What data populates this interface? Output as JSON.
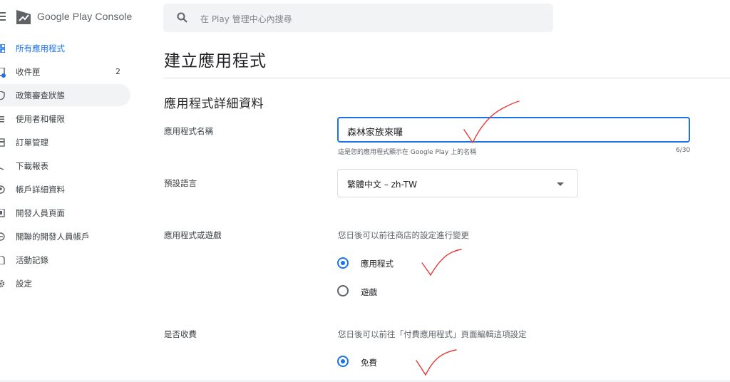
{
  "app": {
    "brand_name": "Google Play Console"
  },
  "sidebar": {
    "items": [
      {
        "label": "所有應用程式",
        "icon": "grid-icon",
        "active": true
      },
      {
        "label": "收件匣",
        "icon": "inbox-icon",
        "count": "2"
      },
      {
        "label": "政策審查狀態",
        "icon": "shield-icon"
      },
      {
        "label": "使用者和權限",
        "icon": "people-icon"
      },
      {
        "label": "訂單管理",
        "icon": "credit-card-icon"
      },
      {
        "label": "下載報表",
        "icon": "download-icon"
      },
      {
        "label": "帳戶詳細資料",
        "icon": "account-icon"
      },
      {
        "label": "開發人員頁面",
        "icon": "page-icon"
      },
      {
        "label": "關聯的開發人員帳戶",
        "icon": "link-icon"
      },
      {
        "label": "活動記錄",
        "icon": "log-icon"
      },
      {
        "label": "設定",
        "icon": "gear-icon"
      }
    ]
  },
  "search": {
    "placeholder": "在 Play 管理中心內搜尋"
  },
  "page": {
    "title": "建立應用程式"
  },
  "form": {
    "section_title": "應用程式詳細資料",
    "app_name": {
      "label": "應用程式名稱",
      "value": "森林家族來囉",
      "hint": "這是您的應用程式顯示在 Google Play 上的名稱",
      "counter": "6/30"
    },
    "default_language": {
      "label": "預設語言",
      "value": "繁體中文 – zh-TW"
    },
    "app_or_game": {
      "label": "應用程式或遊戲",
      "helper": "您日後可以前往商店的設定進行變更",
      "options": [
        {
          "label": "應用程式",
          "selected": true
        },
        {
          "label": "遊戲",
          "selected": false
        }
      ]
    },
    "free_or_paid": {
      "label": "是否收費",
      "helper": "您日後可以前往「付費應用程式」頁面編輯這項設定",
      "options": [
        {
          "label": "免費",
          "selected": true
        }
      ]
    }
  },
  "colors": {
    "accent": "#1a73e8",
    "annotation": "#e53935"
  }
}
